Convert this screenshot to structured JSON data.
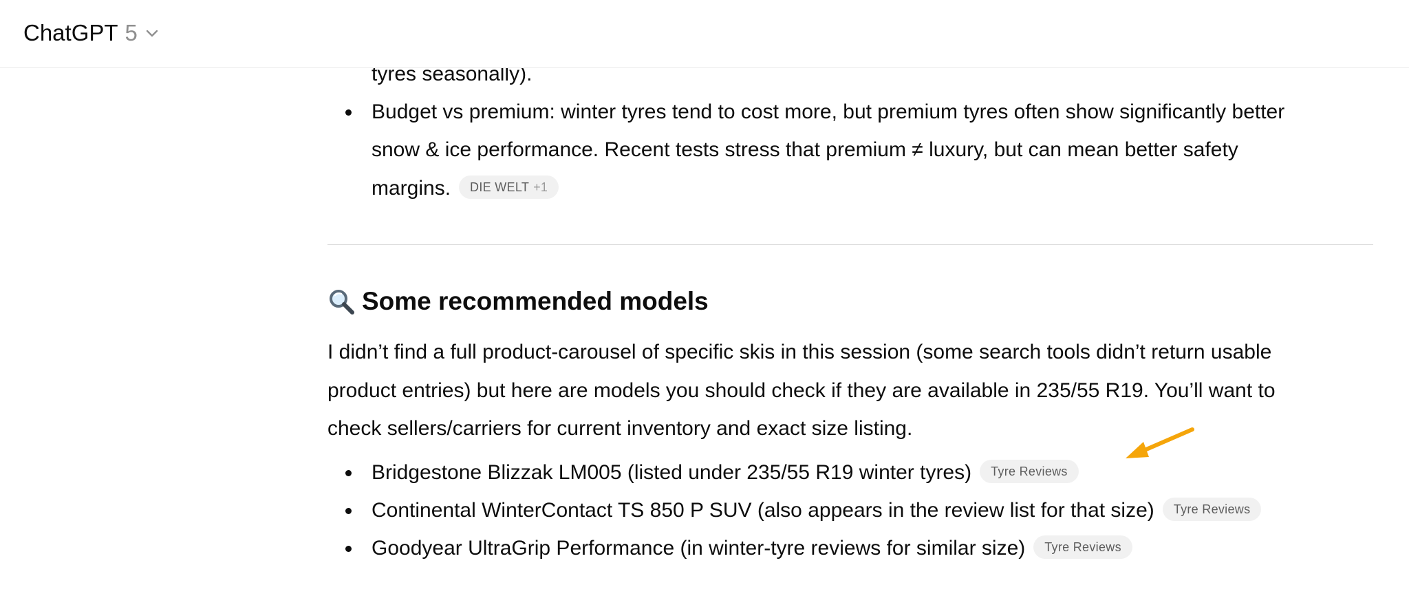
{
  "header": {
    "model_name": "ChatGPT",
    "model_version": "5"
  },
  "message": {
    "prev_bullet_tail": "tyres seasonally).",
    "budget_bullet": {
      "line1": "Budget vs premium: winter tyres tend to cost more, but premium tyres often show significantly better",
      "line2": "snow & ice performance. Recent tests stress that premium ≠ luxury, but can mean better safety",
      "line3": "margins.",
      "citation": "DIE WELT",
      "citation_extra": "+1"
    },
    "section_heading": "Some recommended models",
    "intro": {
      "line1": "I didn’t find a full product-carousel of specific skis in this session (some search tools didn’t return usable",
      "line2": "product entries) but here are models you should check if they are available in 235/55 R19. You’ll want to",
      "line3": "check sellers/carriers for current inventory and exact size listing."
    },
    "models": [
      {
        "text": "Bridgestone Blizzak LM005 (listed under 235/55 R19 winter tyres)",
        "citation": "Tyre Reviews"
      },
      {
        "text": "Continental WinterContact TS 850 P SUV (also appears in the review list for that size)",
        "citation": "Tyre Reviews"
      },
      {
        "text": "Goodyear UltraGrip Performance (in winter-tyre reviews for similar size)",
        "citation": "Tyre Reviews"
      }
    ]
  },
  "icons": {
    "model_dropdown": "chevron-down-icon",
    "heading_icon": "magnifying-glass-icon",
    "annotation": "arrow-annotation-icon"
  },
  "colors": {
    "annotation_arrow": "#f5a50a",
    "citation_pill_bg": "#f1f1f1",
    "divider": "#d9d9d9"
  }
}
